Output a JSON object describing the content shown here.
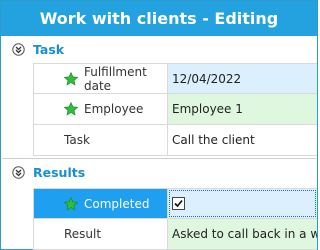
{
  "window": {
    "title": "Work with clients - Editing"
  },
  "sections": [
    {
      "title": "Task",
      "rows": [
        {
          "label": "Fulfillment date",
          "value": "12/04/2022",
          "required": true
        },
        {
          "label": "Employee",
          "value": "Employee 1",
          "required": true
        },
        {
          "label": "Task",
          "value": "Call the client",
          "required": false
        }
      ]
    },
    {
      "title": "Results",
      "rows": [
        {
          "label": "Completed",
          "value": "",
          "required": true,
          "checked": true
        },
        {
          "label": "Result",
          "value": "Asked to call back in a week",
          "required": false
        }
      ]
    }
  ],
  "colors": {
    "title_bar": "#23a2df",
    "section_title": "#1a8fd0",
    "selected_row": "#1e9ff0",
    "value_blue": "#dcefff",
    "value_green": "#dff6df",
    "star": "#2fbf3a"
  },
  "icons": {
    "section_collapse": "chevron-circle-icon",
    "required": "green-star-icon",
    "checkbox": "checkmark-icon"
  }
}
